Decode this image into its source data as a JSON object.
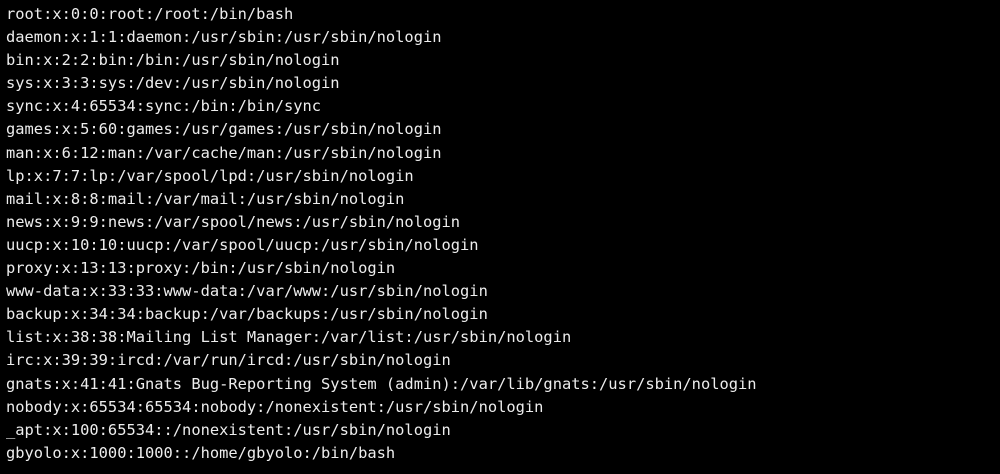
{
  "terminal": {
    "colors": {
      "background": "#000000",
      "text": "#ededed"
    },
    "lines": [
      "root:x:0:0:root:/root:/bin/bash",
      "daemon:x:1:1:daemon:/usr/sbin:/usr/sbin/nologin",
      "bin:x:2:2:bin:/bin:/usr/sbin/nologin",
      "sys:x:3:3:sys:/dev:/usr/sbin/nologin",
      "sync:x:4:65534:sync:/bin:/bin/sync",
      "games:x:5:60:games:/usr/games:/usr/sbin/nologin",
      "man:x:6:12:man:/var/cache/man:/usr/sbin/nologin",
      "lp:x:7:7:lp:/var/spool/lpd:/usr/sbin/nologin",
      "mail:x:8:8:mail:/var/mail:/usr/sbin/nologin",
      "news:x:9:9:news:/var/spool/news:/usr/sbin/nologin",
      "uucp:x:10:10:uucp:/var/spool/uucp:/usr/sbin/nologin",
      "proxy:x:13:13:proxy:/bin:/usr/sbin/nologin",
      "www-data:x:33:33:www-data:/var/www:/usr/sbin/nologin",
      "backup:x:34:34:backup:/var/backups:/usr/sbin/nologin",
      "list:x:38:38:Mailing List Manager:/var/list:/usr/sbin/nologin",
      "irc:x:39:39:ircd:/var/run/ircd:/usr/sbin/nologin",
      "gnats:x:41:41:Gnats Bug-Reporting System (admin):/var/lib/gnats:/usr/sbin/nologin",
      "nobody:x:65534:65534:nobody:/nonexistent:/usr/sbin/nologin",
      "_apt:x:100:65534::/nonexistent:/usr/sbin/nologin",
      "gbyolo:x:1000:1000::/home/gbyolo:/bin/bash"
    ]
  }
}
